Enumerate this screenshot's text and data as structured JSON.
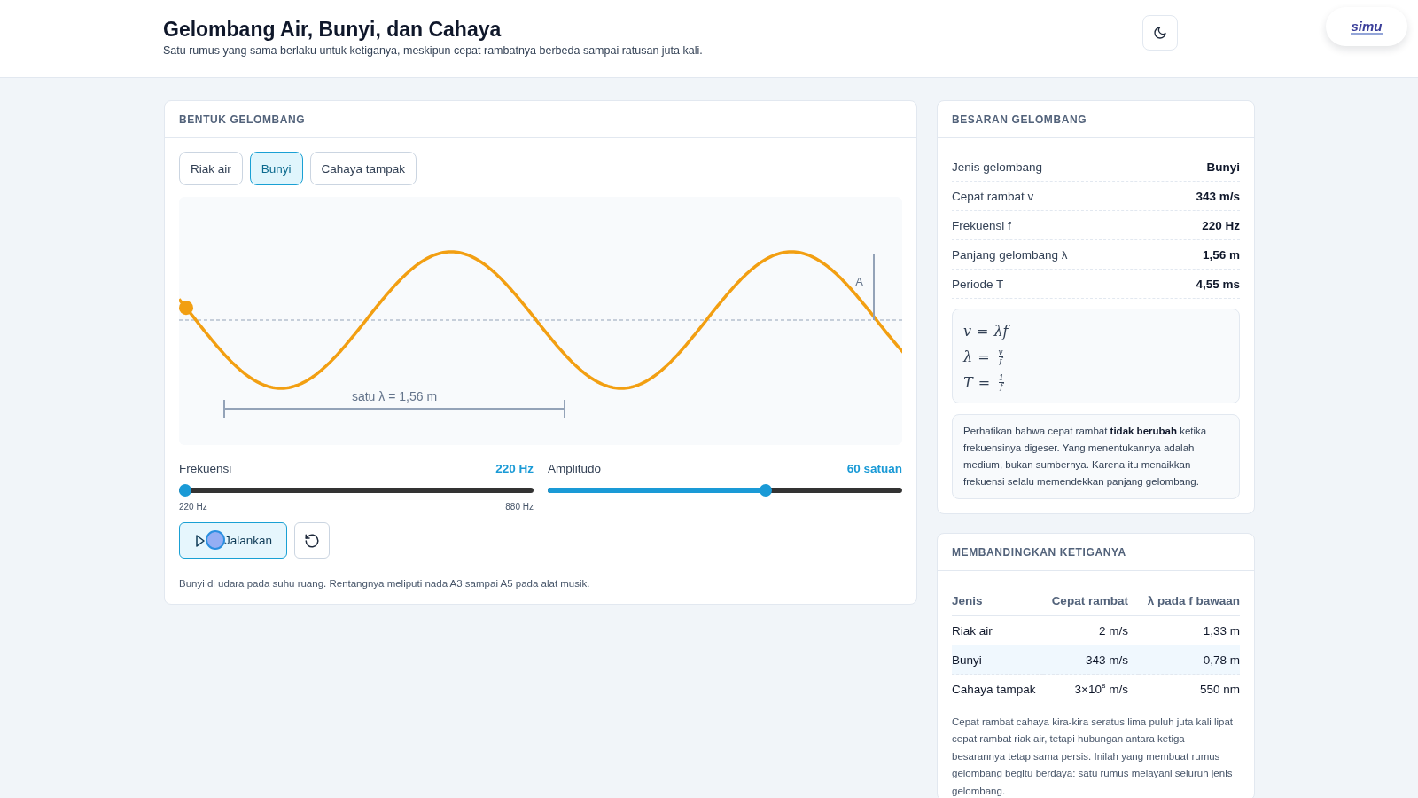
{
  "header": {
    "title": "Gelombang Air, Bunyi, dan Cahaya",
    "subtitle": "Satu rumus yang sama berlaku untuk ketiganya, meskipun cepat rambatnya berbeda sampai ratusan juta kali.",
    "logo": "simu"
  },
  "wave_panel": {
    "heading": "BENTUK GELOMBANG",
    "tabs": [
      {
        "label": "Riak air",
        "selected": false
      },
      {
        "label": "Bunyi",
        "selected": true
      },
      {
        "label": "Cahaya tampak",
        "selected": false
      }
    ],
    "wave": {
      "amplitude_label": "A",
      "wavelength_label": "satu λ = 1,56 m"
    },
    "sliders": [
      {
        "label": "Frekuensi",
        "reading": "220 Hz",
        "level": 0,
        "min_label": "220 Hz",
        "max_label": "880 Hz"
      },
      {
        "label": "Amplitudo",
        "reading": "60 satuan",
        "level": 0.62
      }
    ],
    "run_button": "Jalankan",
    "note": "Bunyi di udara pada suhu ruang. Rentangnya meliputi nada A3 sampai A5 pada alat musik."
  },
  "quantities": {
    "heading": "BESARAN GELOMBANG",
    "rows": [
      {
        "label": "Jenis gelombang",
        "value": "Bunyi"
      },
      {
        "label": "Cepat rambat v",
        "value": "343 m/s"
      },
      {
        "label": "Frekuensi f",
        "value": "220 Hz"
      },
      {
        "label": "Panjang gelombang λ",
        "value": "1,56 m"
      },
      {
        "label": "Periode T",
        "value": "4,55 ms"
      }
    ],
    "formulas": [
      {
        "kind": "product",
        "lhs": "v",
        "sign": "=",
        "rhs": "λf"
      },
      {
        "kind": "fraction",
        "lhs": "λ",
        "sign": "=",
        "num": "v",
        "den": "f"
      },
      {
        "kind": "fraction",
        "lhs": "T",
        "sign": "=",
        "num": "1",
        "den": "f"
      }
    ],
    "note": "Perhatikan bahwa cepat rambat **tidak berubah** ketika frekuensinya digeser. Yang menentukannya adalah medium, bukan sumbernya. Karena itu menaikkan frekuensi selalu memendekkan panjang gelombang."
  },
  "comparison": {
    "heading": "MEMBANDINGKAN KETIGANYA",
    "columns": [
      "Jenis",
      "Cepat rambat",
      "λ pada f bawaan"
    ],
    "rows": [
      {
        "cells": [
          "Riak air",
          "2 m/s",
          "1,33 m"
        ],
        "selected": false
      },
      {
        "cells": [
          "Bunyi",
          "343 m/s",
          "0,78 m"
        ],
        "selected": true
      },
      {
        "cells": [
          "Cahaya tampak",
          "3×10$^{8}$ m/s",
          "550 nm"
        ],
        "selected": false
      }
    ],
    "note": "Cepat rambat cahaya kira-kira seratus lima puluh juta kali lipat cepat rambat riak air, tetapi hubungan antara ketiga besarannya tetap sama persis. Inilah yang membuat rumus gelombang begitu berdaya: satu rumus melayani seluruh jenis gelombang."
  }
}
